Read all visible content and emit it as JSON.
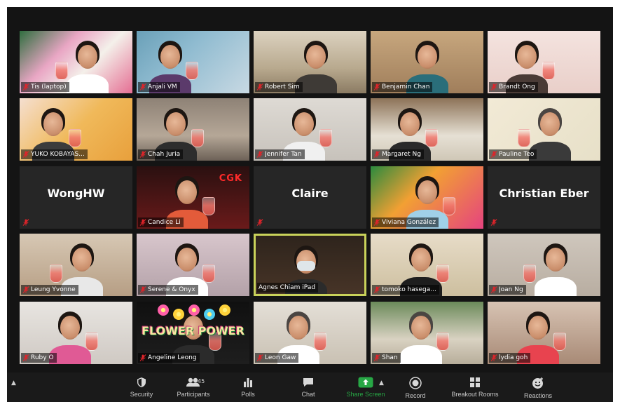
{
  "gallery": {
    "active_speaker_color": "#c9d25a",
    "participants": [
      {
        "name": "Tis (laptop)",
        "video": true,
        "muted": true
      },
      {
        "name": "Anjali VM",
        "video": true,
        "muted": true
      },
      {
        "name": "Robert Sim",
        "video": true,
        "muted": true
      },
      {
        "name": "Benjamin Chan",
        "video": true,
        "muted": true
      },
      {
        "name": "Brandt Ong",
        "video": true,
        "muted": true
      },
      {
        "name": "YUKO KOBAYAS...",
        "video": true,
        "muted": true
      },
      {
        "name": "Chah Juria",
        "video": true,
        "muted": true
      },
      {
        "name": "Jennifer Tan",
        "video": true,
        "muted": true
      },
      {
        "name": "Margaret Ng",
        "video": true,
        "muted": true
      },
      {
        "name": "Pauline Teo",
        "video": true,
        "muted": true
      },
      {
        "name": "WongHW",
        "video": false,
        "muted": true
      },
      {
        "name": "Candice Li",
        "video": true,
        "muted": true
      },
      {
        "name": "Claire",
        "video": false,
        "muted": true
      },
      {
        "name": "Viviana González",
        "video": true,
        "muted": true
      },
      {
        "name": "Christian Eber",
        "video": false,
        "muted": true
      },
      {
        "name": "Leung Yvonne",
        "video": true,
        "muted": true
      },
      {
        "name": "Serene & Onyx",
        "video": true,
        "muted": true
      },
      {
        "name": "Agnes Chiam iPad",
        "video": true,
        "muted": false,
        "active": true
      },
      {
        "name": "tomoko hasega...",
        "video": true,
        "muted": true
      },
      {
        "name": "Joan Ng",
        "video": true,
        "muted": true
      },
      {
        "name": "Ruby O",
        "video": true,
        "muted": true
      },
      {
        "name": "Angeline Leong",
        "video": true,
        "muted": true
      },
      {
        "name": "Leon Gaw",
        "video": true,
        "muted": true
      },
      {
        "name": "Shan",
        "video": true,
        "muted": true
      },
      {
        "name": "lydia goh",
        "video": true,
        "muted": true
      }
    ],
    "overlay_text": {
      "cgk": "CGK",
      "flower_power": "FLOWER POWER"
    }
  },
  "toolbar": {
    "security_label": "Security",
    "participants_label": "Participants",
    "participants_count": "45",
    "polls_label": "Polls",
    "chat_label": "Chat",
    "share_screen_label": "Share Screen",
    "record_label": "Record",
    "breakout_label": "Breakout Rooms",
    "reactions_label": "Reactions",
    "share_color": "#27a745"
  }
}
